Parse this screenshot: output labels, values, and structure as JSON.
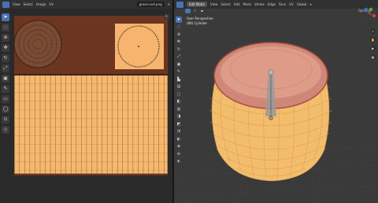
{
  "uv_editor": {
    "menus": [
      "View",
      "Select",
      "Image",
      "UV"
    ],
    "image_name": "grace-uv4.png",
    "tools": [
      "cursor-icon",
      "select-box-icon",
      "cursor-3d-icon",
      "move-icon",
      "rotate-icon",
      "scale-icon",
      "transform-icon",
      "annotate-icon",
      "annotate-line-icon",
      "grab-icon",
      "relax-icon",
      "pinch-icon"
    ]
  },
  "viewport": {
    "mode": "Edit Mode",
    "menus": [
      "View",
      "Select",
      "Add",
      "Mesh",
      "Vertex",
      "Edge",
      "Face",
      "UV"
    ],
    "transform": "Global",
    "overlay_line1": "User Perspective",
    "overlay_line2": "(88) Cylinder",
    "options_label": "Options",
    "tools": [
      "cursor-icon",
      "select-box-icon",
      "cursor-3d-icon",
      "move-icon",
      "rotate-icon",
      "scale-icon",
      "transform-icon",
      "annotate-icon",
      "measure-icon",
      "extrude-icon",
      "inset-icon",
      "bevel-icon",
      "loop-cut-icon",
      "knife-icon",
      "poly-build-icon",
      "spin-icon",
      "smooth-icon",
      "shrink-fatten-icon",
      "shear-icon",
      "rip-icon"
    ],
    "gizmo_axes": [
      "x",
      "y",
      "z"
    ]
  }
}
